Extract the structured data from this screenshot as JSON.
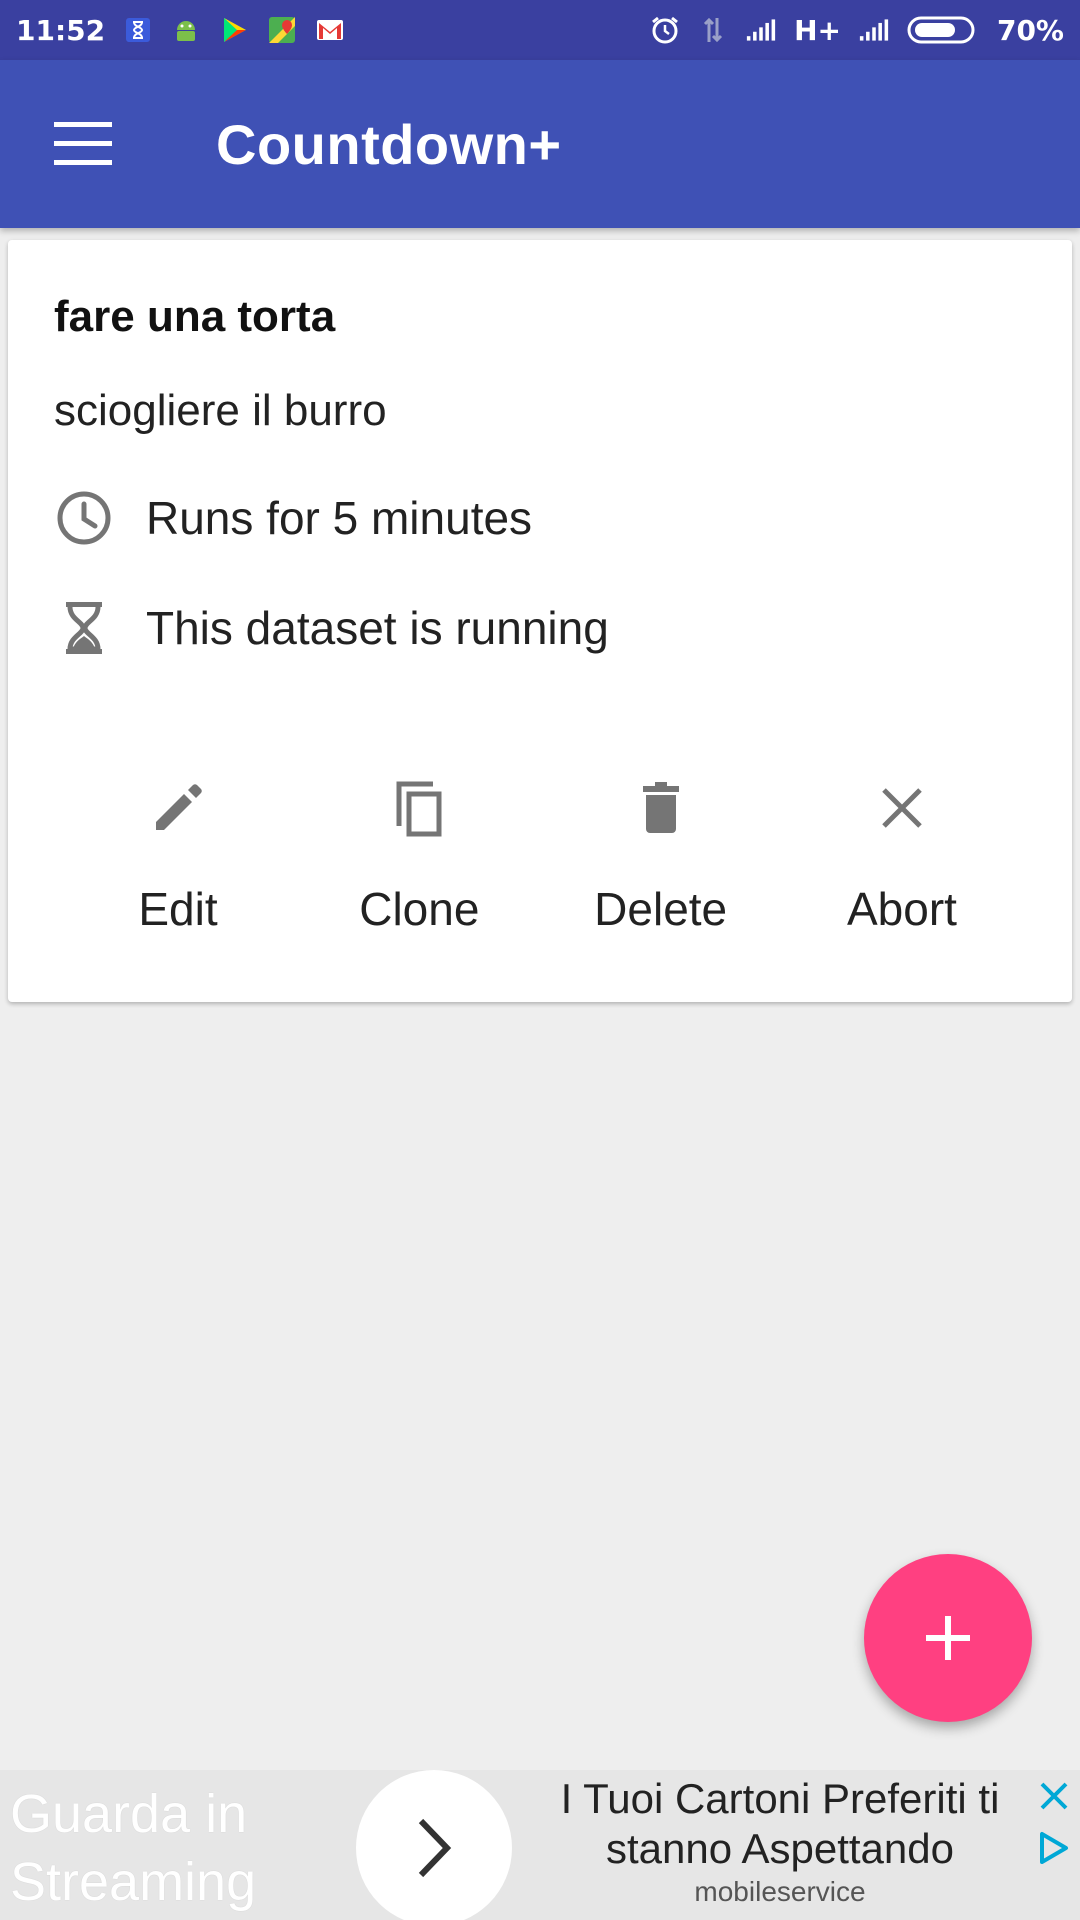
{
  "status_bar": {
    "time": "11:52",
    "network": "H+",
    "battery": "70%",
    "notification_icons": [
      "hourglass-icon",
      "android-icon",
      "play-store-icon",
      "maps-icon",
      "gmail-icon"
    ],
    "system_icons": [
      "alarm-icon",
      "data-arrows-icon",
      "signal-icon",
      "signal-icon",
      "battery-icon"
    ]
  },
  "app_bar": {
    "title": "Countdown+",
    "menu_icon": "hamburger-menu-icon",
    "background": "#3f51b5"
  },
  "card": {
    "title": "fare una torta",
    "subtitle": "sciogliere il burro",
    "duration_text": "Runs for 5 minutes",
    "status_text": "This dataset is running",
    "actions": [
      {
        "label": "Edit",
        "icon": "pencil-icon"
      },
      {
        "label": "Clone",
        "icon": "copy-icon"
      },
      {
        "label": "Delete",
        "icon": "trash-icon"
      },
      {
        "label": "Abort",
        "icon": "close-icon"
      }
    ]
  },
  "fab": {
    "icon": "plus-icon",
    "color": "#ff4081"
  },
  "ad": {
    "left_text": "Guarda in Streaming",
    "headline": "I Tuoi Cartoni Preferiti ti stanno Aspettando",
    "source": "mobileservice"
  }
}
